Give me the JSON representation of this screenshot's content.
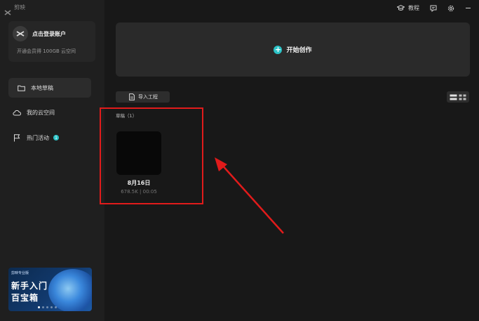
{
  "app": {
    "name": "剪映"
  },
  "sidebar": {
    "login": {
      "title": "点击登录账户",
      "subtitle": "开通会员得 100GB 云空间"
    },
    "nav": [
      {
        "label": "本地草稿",
        "icon": "folder-icon",
        "active": true
      },
      {
        "label": "我的云空间",
        "icon": "cloud-icon",
        "active": false
      },
      {
        "label": "热门活动",
        "icon": "flag-icon",
        "active": false,
        "badge": "1"
      }
    ],
    "promo": {
      "header": "剪映专业版",
      "line1": "新手入门",
      "line2": "百宝箱"
    }
  },
  "topbar": {
    "tutorial_label": "教程"
  },
  "main": {
    "create_label": "开始创作",
    "import_label": "导入工程",
    "drafts_heading": "草稿（1）",
    "drafts": [
      {
        "name": "8月16日",
        "meta": "678.5K | 00:05"
      }
    ]
  },
  "colors": {
    "accent": "#2bc3c7",
    "annotation": "#e11b1b",
    "background": "#181818",
    "sidebar": "#1f1f1f"
  }
}
